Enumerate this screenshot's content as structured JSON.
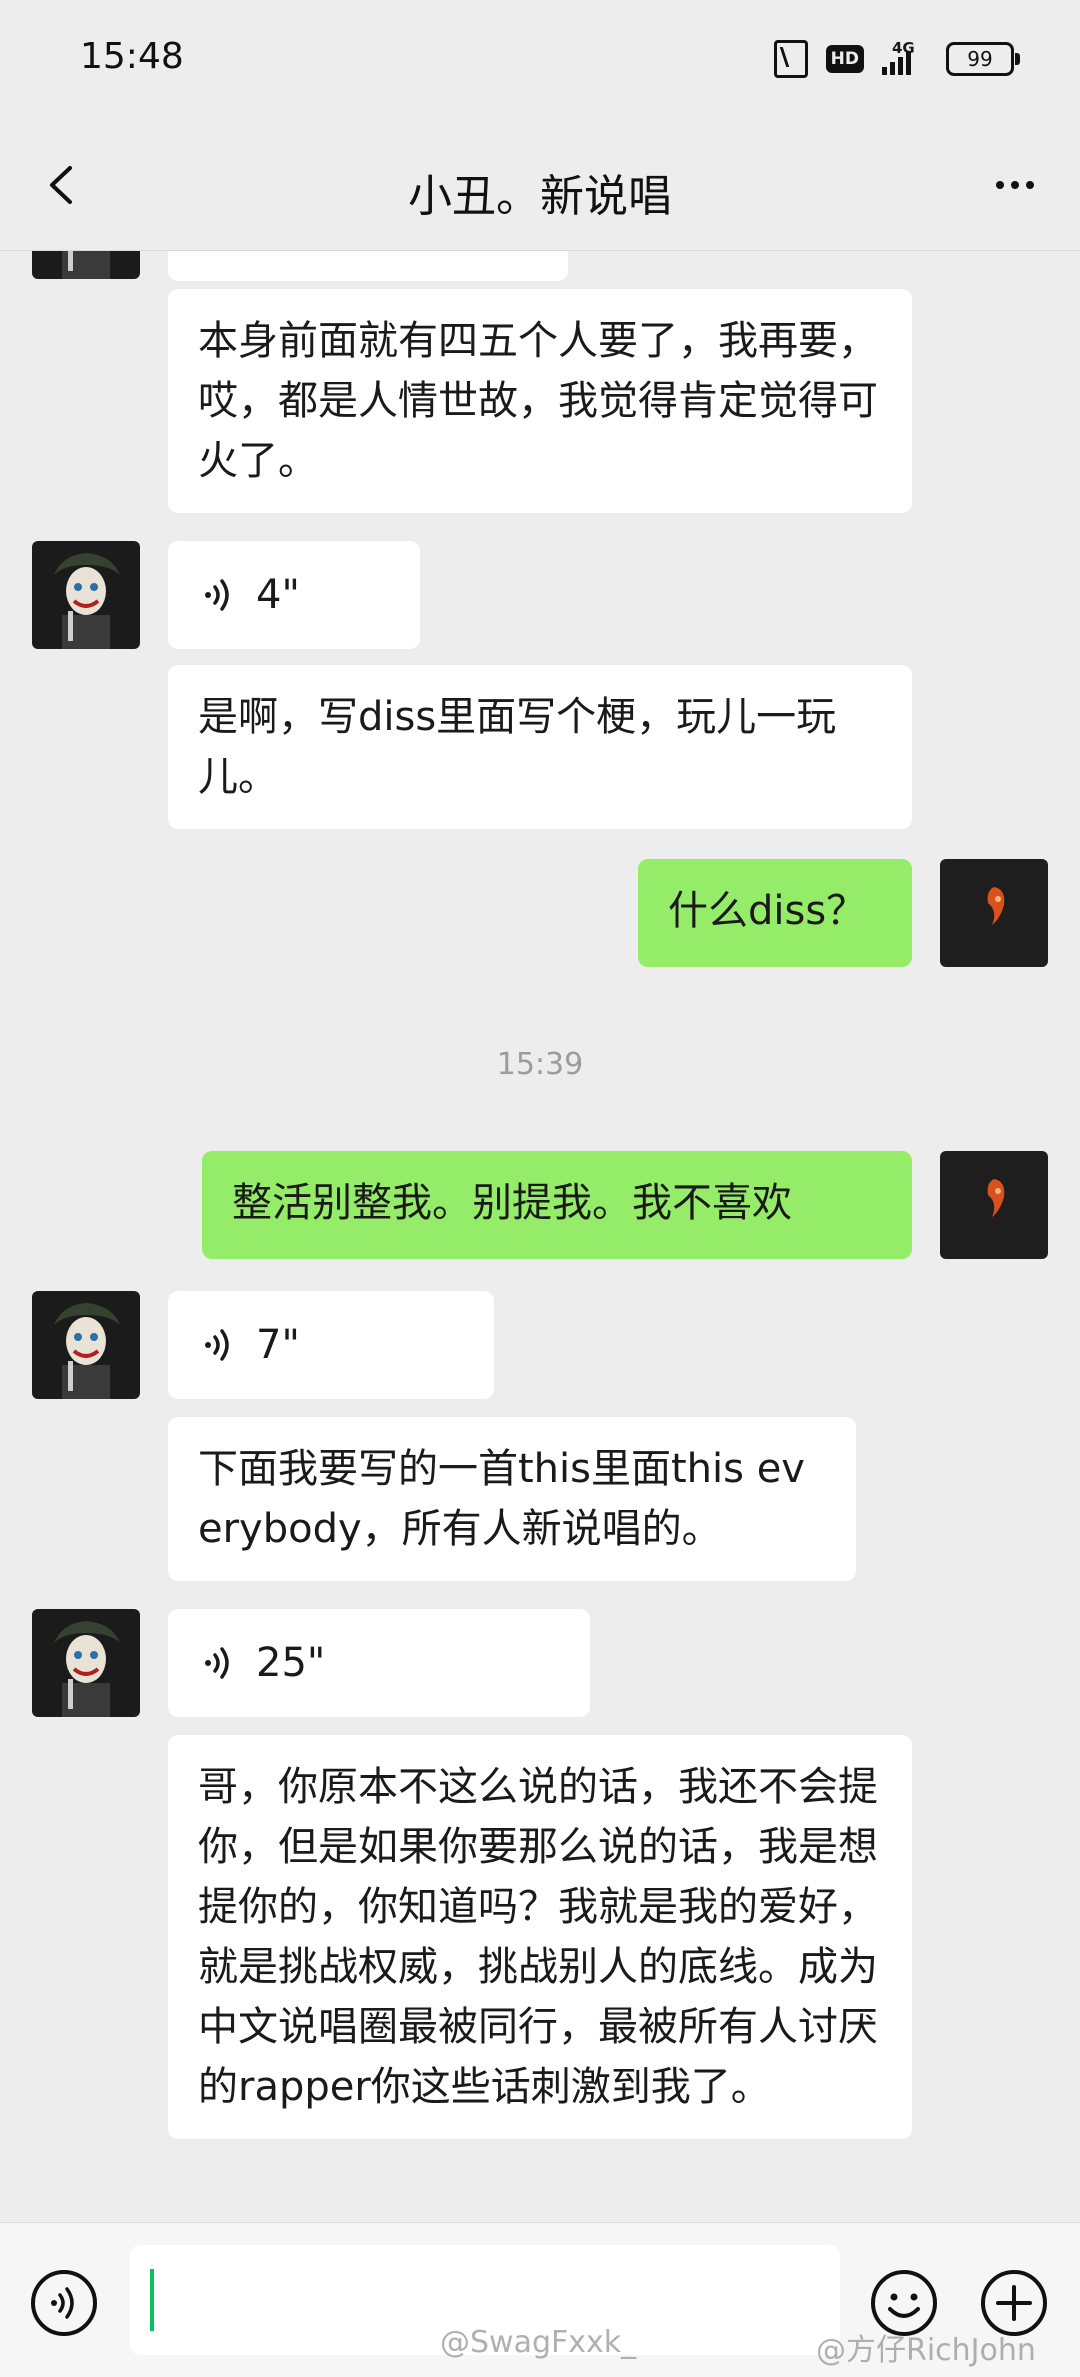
{
  "status_bar": {
    "time": "15:48",
    "hd_label": "HD",
    "network_label": "4G",
    "battery": "99"
  },
  "header": {
    "title": "小丑。新说唱"
  },
  "messages": [
    {
      "type": "text",
      "side": "left",
      "text": "本身前面就有四五个人要了，我再要，哎，都是人情世故，我觉得肯定觉得可火了。"
    },
    {
      "type": "voice",
      "side": "left",
      "duration": "4\""
    },
    {
      "type": "text",
      "side": "left",
      "text": "是啊，写diss里面写个梗，玩儿一玩儿。"
    },
    {
      "type": "text",
      "side": "right",
      "text": "什么diss？"
    },
    {
      "type": "timestamp",
      "text": "15:39"
    },
    {
      "type": "text",
      "side": "right",
      "text": "整活别整我。别提我。我不喜欢"
    },
    {
      "type": "voice",
      "side": "left",
      "duration": "7\""
    },
    {
      "type": "text",
      "side": "left",
      "text": "下面我要写的一首this里面this everybody，所有人新说唱的。"
    },
    {
      "type": "voice",
      "side": "left",
      "duration": "25\""
    },
    {
      "type": "text",
      "side": "left",
      "text": "哥，你原本不这么说的话，我还不会提你，但是如果你要那么说的话，我是想提你的，你知道吗？我就是我的爱好，就是挑战权威，挑战别人的底线。成为中文说唱圈最被同行，最被所有人讨厌的rapper你这些话刺激到我了。"
    }
  ],
  "watermarks": {
    "left": "@SwagFxxk_",
    "right": "@方仔RichJohn"
  },
  "colors": {
    "background": "#ededed",
    "self_bubble": "#95ec69",
    "other_bubble": "#ffffff",
    "cursor": "#07c160"
  }
}
